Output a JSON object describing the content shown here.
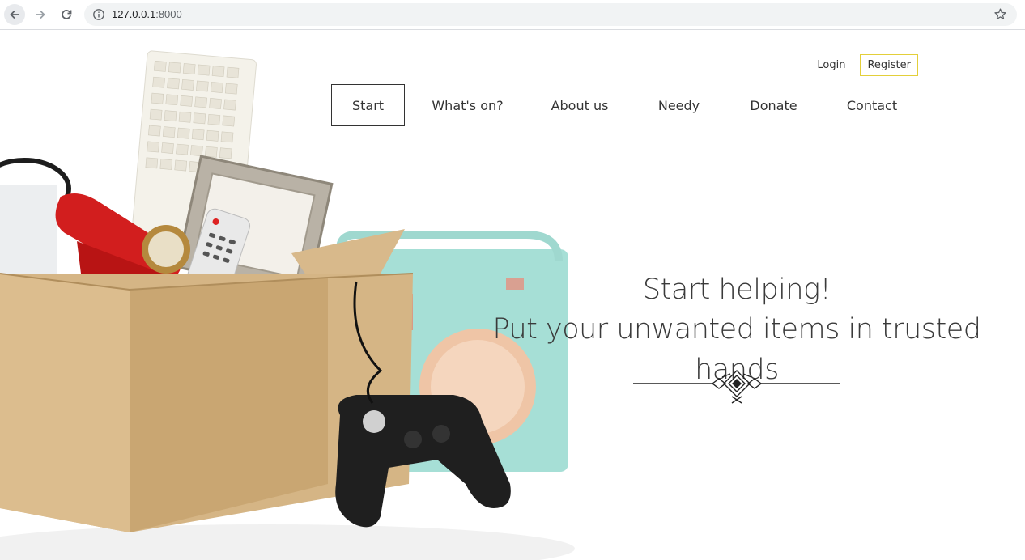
{
  "browser": {
    "url_host": "127.0.0.1",
    "url_port": ":8000",
    "icons": [
      "back-arrow-icon",
      "forward-arrow-icon",
      "reload-icon",
      "info-icon",
      "star-icon"
    ]
  },
  "auth": {
    "login": "Login",
    "register": "Register",
    "register_border_color": "#e3cf3a"
  },
  "menu": {
    "items": [
      {
        "label": "Start",
        "active": true
      },
      {
        "label": "What's on?"
      },
      {
        "label": "About us"
      },
      {
        "label": "Needy"
      },
      {
        "label": "Donate"
      },
      {
        "label": "Contact"
      }
    ]
  },
  "hero": {
    "line1": "Start helping!",
    "line2": "Put your unwanted items in trusted hands"
  }
}
